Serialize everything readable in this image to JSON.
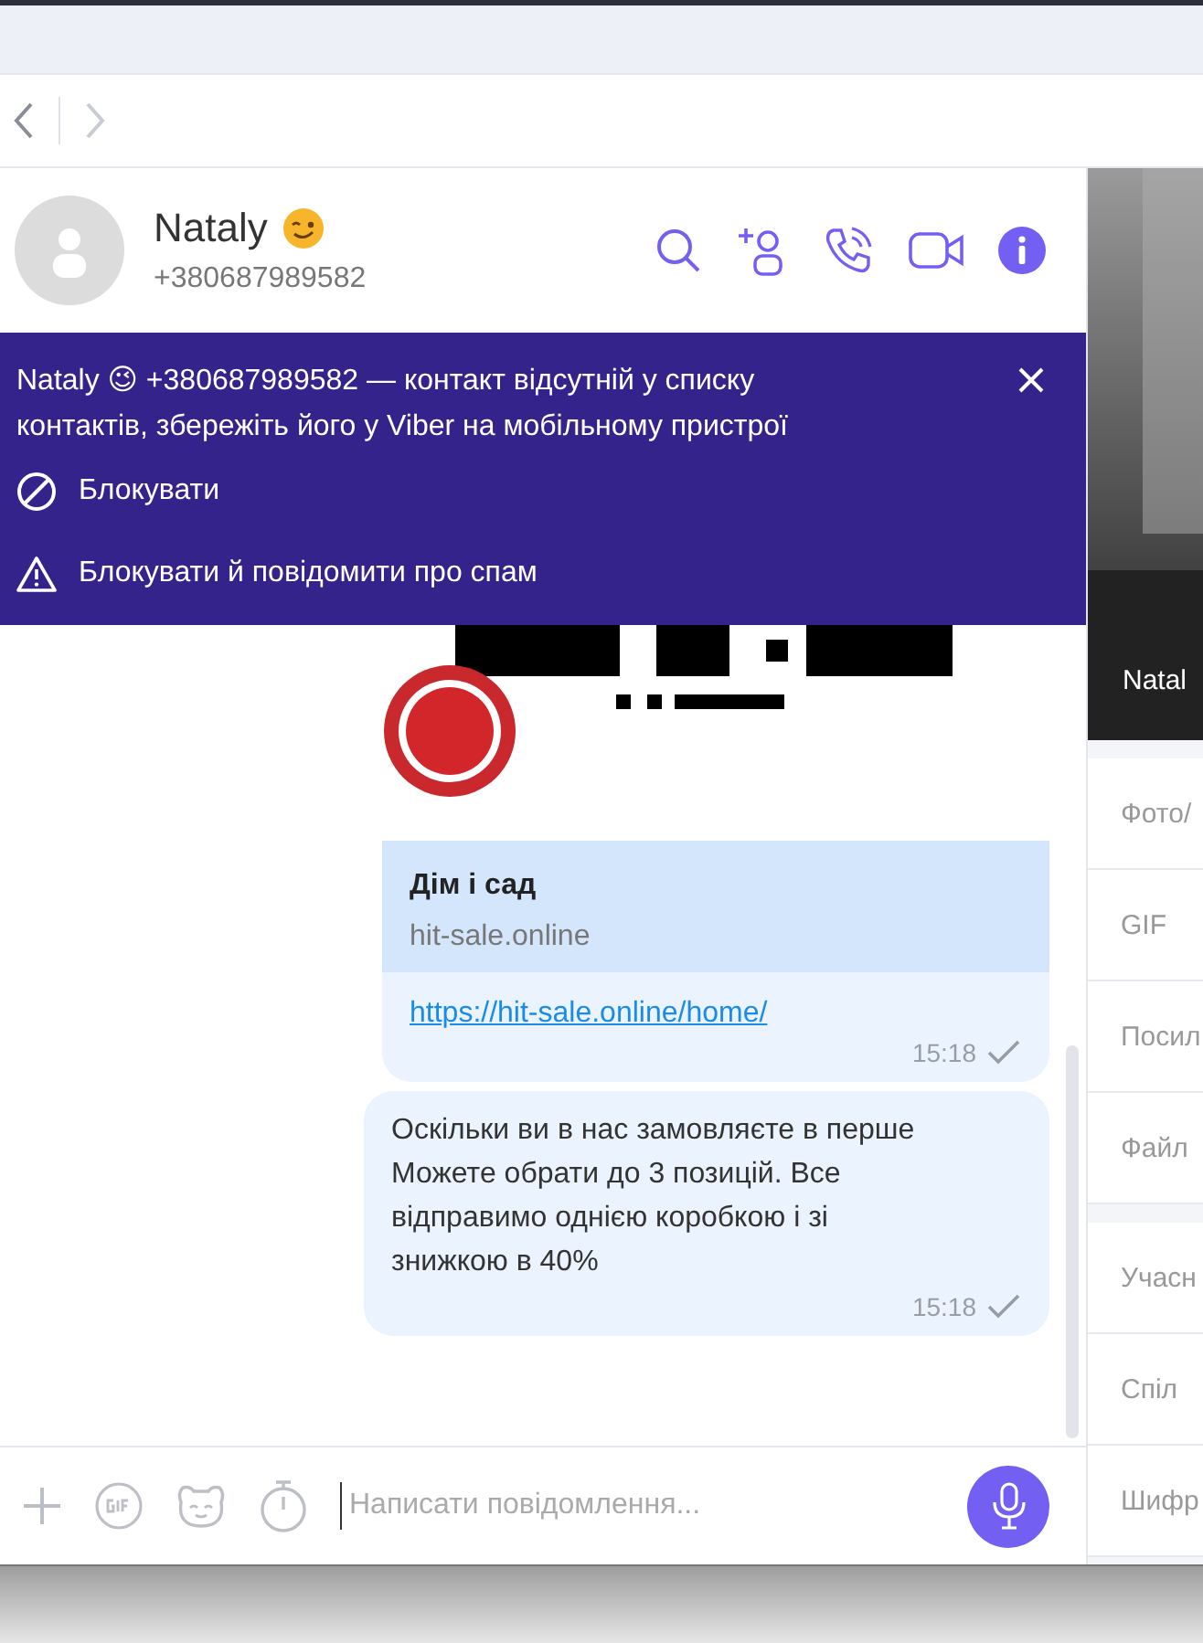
{
  "contact": {
    "name": "Nataly",
    "phone": "+380687989582"
  },
  "notice": {
    "message": "Nataly 😉 +380687989582 — контакт відсутній у списку контактів, збережіть його у Viber на мобільному пристрої",
    "actions": [
      {
        "kind": "block",
        "label": "Блокувати"
      },
      {
        "kind": "report",
        "label": "Блокувати й повідомити про спам"
      }
    ]
  },
  "messages": [
    {
      "kind": "link",
      "title": "Дім і сад",
      "domain": "hit-sale.online",
      "url": "https://hit-sale.online/home/",
      "time": "15:18"
    },
    {
      "kind": "text",
      "text": "Оскільки ви в нас замовляєте в перше\nМожете обрати до 3 позицій. Все відправимо однією коробкою і зі знижкою в 40%",
      "time": "15:18"
    }
  ],
  "composer": {
    "placeholder": "Написати повідомлення..."
  },
  "side_panel": {
    "photo_caption": "Natal",
    "sections": [
      {
        "items": [
          "Фото/",
          "GIF",
          "Посил",
          "Файл"
        ]
      },
      {
        "items": [
          "Учасн",
          "Спіл",
          "Шифр"
        ]
      }
    ]
  }
}
